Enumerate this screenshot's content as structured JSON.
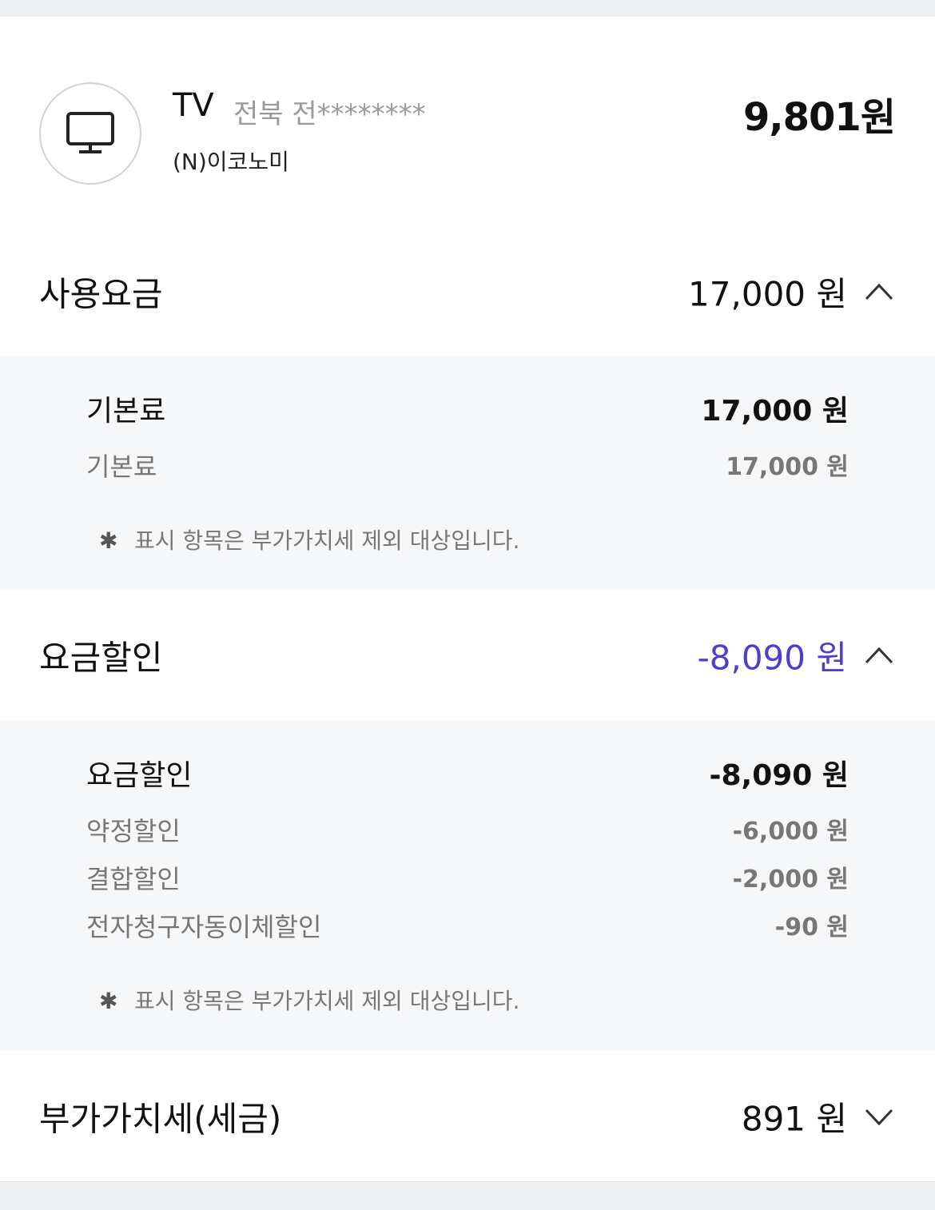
{
  "service": {
    "icon": "tv-icon",
    "name": "TV",
    "owner": "전북 전********",
    "plan": "(N)이코노미",
    "total": "9,801원"
  },
  "usage": {
    "title": "사용요금",
    "amount": "17,000 원",
    "expanded": true,
    "main": {
      "label": "기본료",
      "value": "17,000 원"
    },
    "items": [
      {
        "label": "기본료",
        "value": "17,000 원"
      }
    ],
    "note": "표시 항목은 부가가치세 제외 대상입니다."
  },
  "discount": {
    "title": "요금할인",
    "amount": "-8,090 원",
    "expanded": true,
    "amount_color": "#4a3fd0",
    "main": {
      "label": "요금할인",
      "value": "-8,090 원"
    },
    "items": [
      {
        "label": "약정할인",
        "value": "-6,000 원"
      },
      {
        "label": "결합할인",
        "value": "-2,000 원"
      },
      {
        "label": "전자청구자동이체할인",
        "value": "-90 원"
      }
    ],
    "note": "표시 항목은 부가가치세 제외 대상입니다."
  },
  "vat": {
    "title": "부가가치세(세금)",
    "amount": "891 원",
    "expanded": false
  },
  "note_symbol": "✱"
}
